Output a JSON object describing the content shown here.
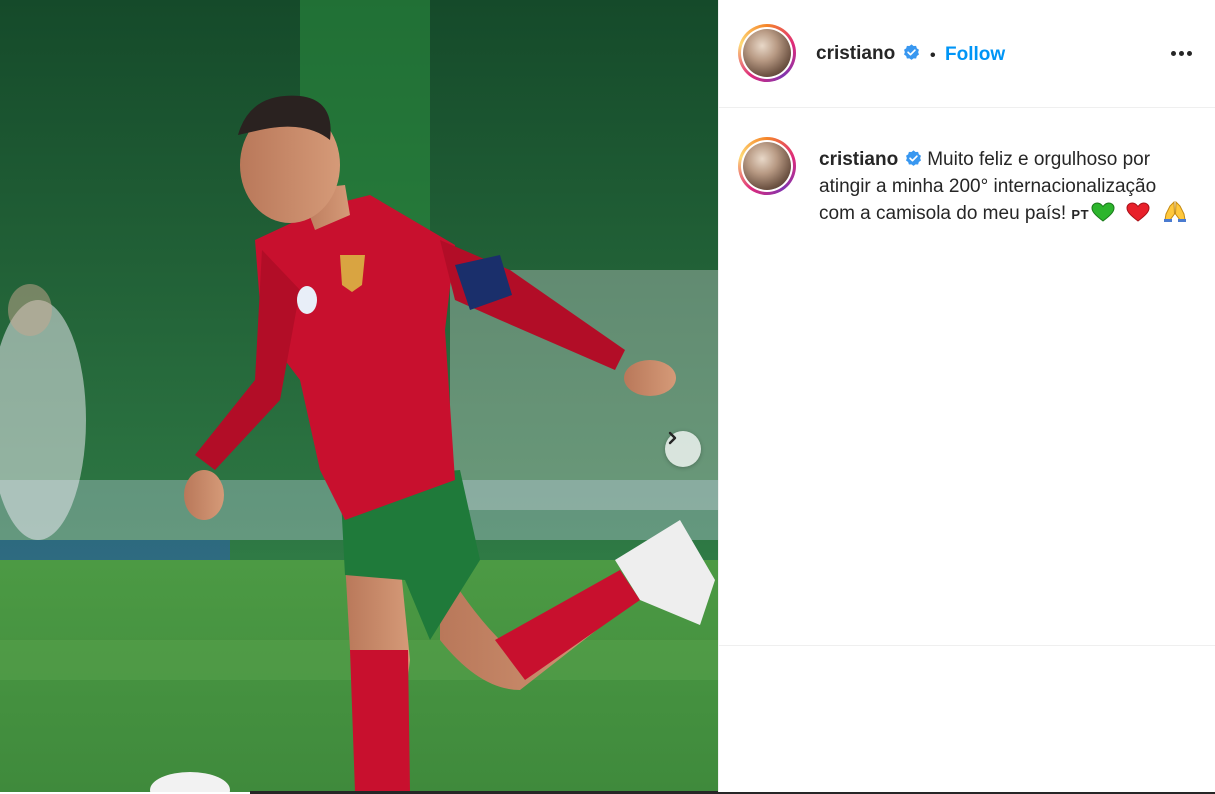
{
  "post": {
    "username": "cristiano",
    "follow_label": "Follow",
    "separator": "•",
    "caption_text": "Muito feliz e orgulhoso por atingir a minha 200° internacionalização com a camisola do meu país!",
    "caption_flag": "PT",
    "caption_emojis": [
      "green-heart",
      "red-heart",
      "folded-hands"
    ]
  },
  "media": {
    "description_icon": "photo",
    "carousel_next_icon": "chevron-right-icon"
  },
  "colors": {
    "link_blue": "#0095f6",
    "verified_blue": "#3897f0",
    "text": "#262626",
    "jersey_red": "#c8102e",
    "shorts_green": "#1f7a3a"
  }
}
